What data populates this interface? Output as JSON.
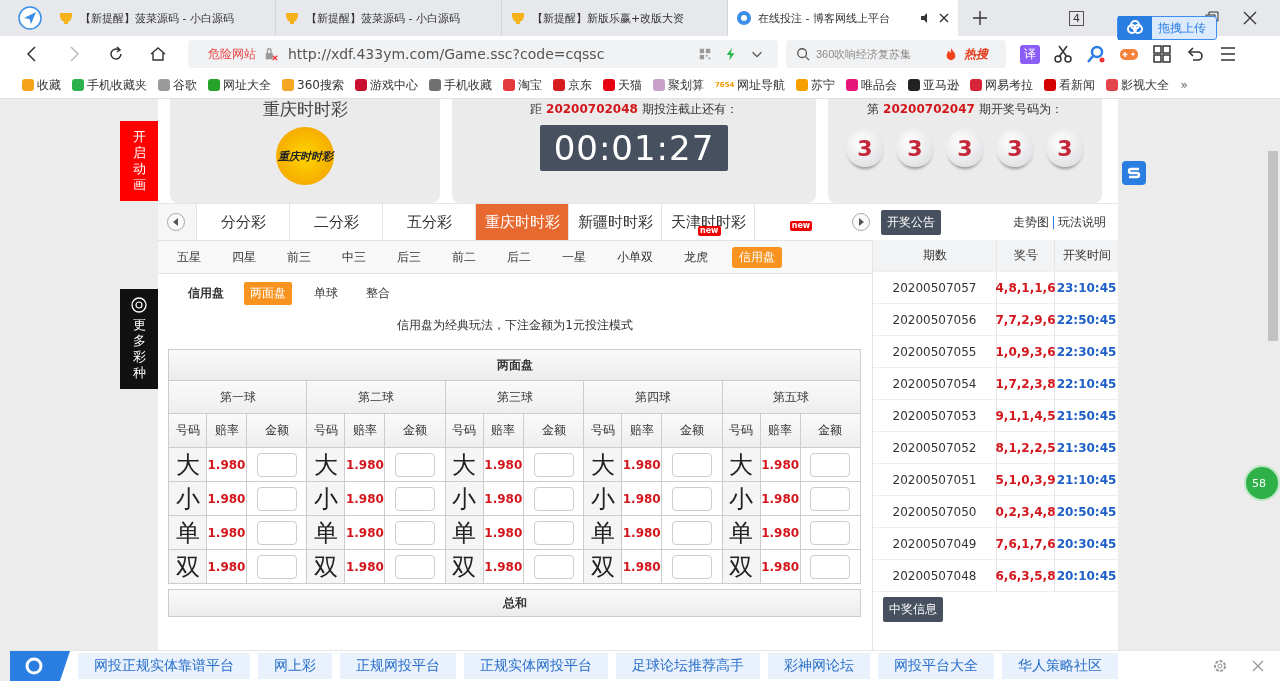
{
  "browser": {
    "tabs": [
      {
        "title": "【新提醒】菠菜源码 - 小白源码",
        "selected": false,
        "sound": false
      },
      {
        "title": "【新提醒】菠菜源码 - 小白源码",
        "selected": false,
        "sound": false
      },
      {
        "title": "【新提醒】新版乐赢+改版大资",
        "selected": false,
        "sound": false
      },
      {
        "title": "在线投注 - 博客网线上平台",
        "selected": true,
        "sound": true
      }
    ],
    "tab_count": "4",
    "upload_button": "拖拽上传",
    "url_warning": "危险网站",
    "url": "http://xdf.433ym.com/Game.ssc?code=cqssc",
    "search_placeholder": "360吹响经济复苏集",
    "hot_search": "热搜",
    "translate": "译",
    "bookmarks": [
      {
        "label": "收藏",
        "color": "#f7a21b"
      },
      {
        "label": "手机收藏夹",
        "color": "#2bb24c"
      },
      {
        "label": "谷歌",
        "color": "#9a9a9a"
      },
      {
        "label": "网址大全",
        "color": "#27a32a"
      },
      {
        "label": "360搜索",
        "color": "#f5a623"
      },
      {
        "label": "游戏中心",
        "color": "#c8102e"
      },
      {
        "label": "手机收藏",
        "color": "#707070"
      },
      {
        "label": "淘宝",
        "color": "#e4393c"
      },
      {
        "label": "京东",
        "color": "#d71c1e"
      },
      {
        "label": "天猫",
        "color": "#e60012"
      },
      {
        "label": "聚划算",
        "color": "#c9a0c9"
      },
      {
        "label": "网址导航",
        "color": "#f39800"
      },
      {
        "label": "苏宁",
        "color": "#f6a000"
      },
      {
        "label": "唯品会",
        "color": "#e5157a"
      },
      {
        "label": "亚马逊",
        "color": "#222222"
      },
      {
        "label": "网易考拉",
        "color": "#d7243a"
      },
      {
        "label": "看新闻",
        "color": "#d40000"
      },
      {
        "label": "影视大全",
        "color": "#e3434b"
      }
    ],
    "nav_badge": "7654",
    "more": "»"
  },
  "side_buttons": [
    {
      "kind": "animation",
      "text": "开启动画"
    },
    {
      "kind": "more",
      "text": "更多彩种"
    }
  ],
  "header": {
    "lottery_name": "重庆时时彩",
    "logo_text": "重庆时时彩",
    "countdown_prefix": "距",
    "countdown_issue": "20200702048",
    "countdown_suffix": "期投注截止还有：",
    "countdown": "00:01:27",
    "draw_prefix": "第",
    "draw_issue": "20200702047",
    "draw_suffix": "期开奖号码为：",
    "draw_balls": [
      "3",
      "3",
      "3",
      "3",
      "3"
    ]
  },
  "game_tabs": [
    {
      "label": "分分彩",
      "selected": false
    },
    {
      "label": "二分彩",
      "selected": false
    },
    {
      "label": "五分彩",
      "selected": false
    },
    {
      "label": "重庆时时彩",
      "selected": true
    },
    {
      "label": "新疆时时彩",
      "selected": false
    },
    {
      "label": "天津时时彩",
      "selected": false,
      "badge": "new"
    },
    {
      "selected": false,
      "badge": "new"
    }
  ],
  "play_tabs": [
    {
      "label": "五星",
      "selected": false
    },
    {
      "label": "四星",
      "selected": false
    },
    {
      "label": "前三",
      "selected": false
    },
    {
      "label": "中三",
      "selected": false
    },
    {
      "label": "后三",
      "selected": false
    },
    {
      "label": "前二",
      "selected": false
    },
    {
      "label": "后二",
      "selected": false
    },
    {
      "label": "一星",
      "selected": false
    },
    {
      "label": "小单双",
      "selected": false
    },
    {
      "label": "龙虎",
      "selected": false
    },
    {
      "label": "信用盘",
      "selected": true
    }
  ],
  "mode_label": "信用盘",
  "modes": [
    {
      "label": "两面盘",
      "selected": true
    },
    {
      "label": "单球",
      "selected": false
    },
    {
      "label": "整合",
      "selected": false
    }
  ],
  "note": "信用盘为经典玩法，下注金额为1元投注模式",
  "bet_table": {
    "title": "两面盘",
    "balls": [
      {
        "name": "第一球",
        "columns": [
          "号码",
          "赔率",
          "金额"
        ],
        "items": [
          {
            "code": "大",
            "odds": "1.980"
          },
          {
            "code": "小",
            "odds": "1.980"
          },
          {
            "code": "单",
            "odds": "1.980"
          },
          {
            "code": "双",
            "odds": "1.980"
          }
        ]
      },
      {
        "name": "第二球",
        "columns": [
          "号码",
          "赔率",
          "金额"
        ],
        "items": [
          {
            "code": "大",
            "odds": "1.980"
          },
          {
            "code": "小",
            "odds": "1.980"
          },
          {
            "code": "单",
            "odds": "1.980"
          },
          {
            "code": "双",
            "odds": "1.980"
          }
        ]
      },
      {
        "name": "第三球",
        "columns": [
          "号码",
          "赔率",
          "金额"
        ],
        "items": [
          {
            "code": "大",
            "odds": "1.980"
          },
          {
            "code": "小",
            "odds": "1.980"
          },
          {
            "code": "单",
            "odds": "1.980"
          },
          {
            "code": "双",
            "odds": "1.980"
          }
        ]
      },
      {
        "name": "第四球",
        "columns": [
          "号码",
          "赔率",
          "金额"
        ],
        "items": [
          {
            "code": "大",
            "odds": "1.980"
          },
          {
            "code": "小",
            "odds": "1.980"
          },
          {
            "code": "单",
            "odds": "1.980"
          },
          {
            "code": "双",
            "odds": "1.980"
          }
        ]
      },
      {
        "name": "第五球",
        "columns": [
          "号码",
          "赔率",
          "金额"
        ],
        "items": [
          {
            "code": "大",
            "odds": "1.980"
          },
          {
            "code": "小",
            "odds": "1.980"
          },
          {
            "code": "单",
            "odds": "1.980"
          },
          {
            "code": "双",
            "odds": "1.980"
          }
        ]
      }
    ],
    "next_section": "总和"
  },
  "results": {
    "button": "开奖公告",
    "links": [
      "走势图",
      "玩法说明"
    ],
    "columns": [
      "期数",
      "奖号",
      "开奖时间"
    ],
    "rows": [
      {
        "issue": "20200507057",
        "numbers": "4,8,1,1,6",
        "time": "23:10:45"
      },
      {
        "issue": "20200507056",
        "numbers": "7,7,2,9,6",
        "time": "22:50:45"
      },
      {
        "issue": "20200507055",
        "numbers": "1,0,9,3,6",
        "time": "22:30:45"
      },
      {
        "issue": "20200507054",
        "numbers": "1,7,2,3,8",
        "time": "22:10:45"
      },
      {
        "issue": "20200507053",
        "numbers": "9,1,1,4,5",
        "time": "21:50:45"
      },
      {
        "issue": "20200507052",
        "numbers": "8,1,2,2,5",
        "time": "21:30:45"
      },
      {
        "issue": "20200507051",
        "numbers": "5,1,0,3,9",
        "time": "21:10:45"
      },
      {
        "issue": "20200507050",
        "numbers": "0,2,3,4,8",
        "time": "20:50:45"
      },
      {
        "issue": "20200507049",
        "numbers": "7,6,1,7,6",
        "time": "20:30:45"
      },
      {
        "issue": "20200507048",
        "numbers": "6,6,3,5,8",
        "time": "20:10:45"
      }
    ],
    "next_button": "中奖信息"
  },
  "float_badge": "58",
  "bottom_links": [
    "网投正规实体靠谱平台",
    "网上彩",
    "正规网投平台",
    "正规实体网投平台",
    "足球论坛推荐高手",
    "彩神网论坛",
    "网投平台大全",
    "华人策略社区"
  ]
}
